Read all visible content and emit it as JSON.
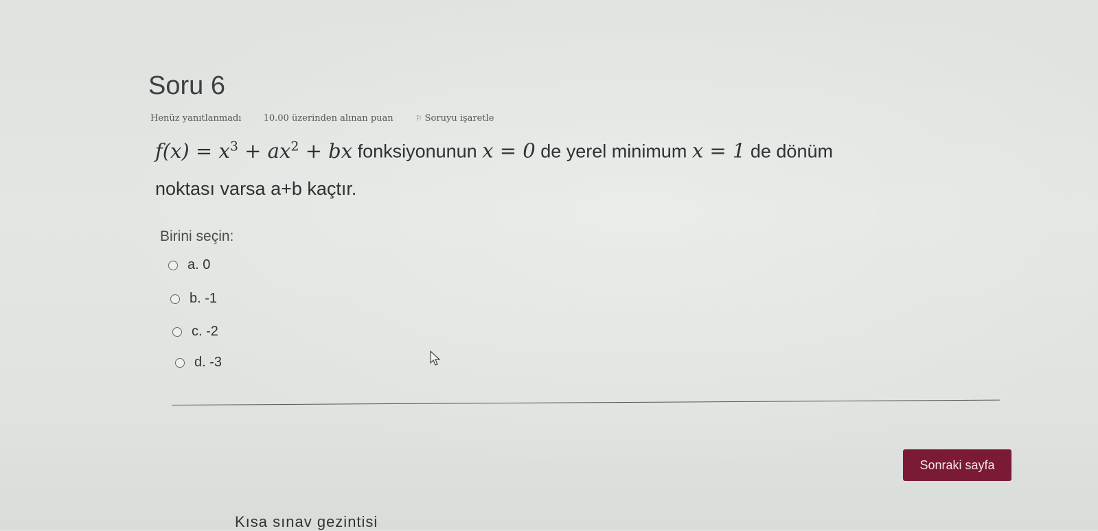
{
  "question": {
    "title": "Soru 6",
    "status": "Henüz yanıtlanmadı",
    "points": "10.00 üzerinden alınan puan",
    "flag_label": "Soruyu işaretle",
    "text": {
      "formula_lhs": "f(x)",
      "formula_eq": " = ",
      "formula_x": "x",
      "formula_exp3": "3",
      "formula_plus_ax": " + ax",
      "formula_exp2": "2",
      "formula_plus_bx": " + bx",
      "part1": " fonksiyonunun ",
      "cond1": "x = 0",
      "part2": " de yerel minimum ",
      "cond2": "x = 1",
      "part3": " de dönüm",
      "part4": "noktası varsa a+b kaçtır."
    }
  },
  "choose_label": "Birini seçin:",
  "options": [
    {
      "label": "a. 0"
    },
    {
      "label": "b. -1"
    },
    {
      "label": "c. -2"
    },
    {
      "label": "d. -3"
    }
  ],
  "next_button": "Sonraki sayfa",
  "nav_heading": "Kısa sınav gezintisi",
  "colors": {
    "button_bg": "#7a1a35",
    "background": "#e0e3df"
  }
}
